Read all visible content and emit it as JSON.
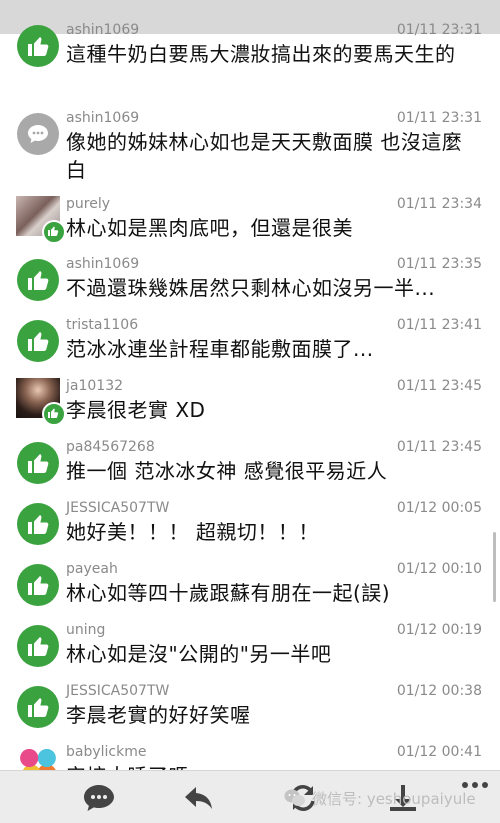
{
  "comments": [
    {
      "user": "ashin1069",
      "time": "01/11 23:31",
      "text": "這種牛奶白要馬大濃妝搞出來的要馬天生的",
      "avatar": "like"
    },
    {
      "user": "ashin1069",
      "time": "01/11 23:31",
      "text": "像她的姊妹林心如也是天天敷面膜 也沒這麼白",
      "avatar": "chat"
    },
    {
      "user": "purely",
      "time": "01/11 23:34",
      "text": "林心如是黑肉底吧，但還是很美",
      "avatar": "photo"
    },
    {
      "user": "ashin1069",
      "time": "01/11 23:35",
      "text": "不過還珠幾姝居然只剩林心如沒另一半...",
      "avatar": "like"
    },
    {
      "user": "trista1106",
      "time": "01/11 23:41",
      "text": "范冰冰連坐計程車都能敷面膜了...",
      "avatar": "like"
    },
    {
      "user": "ja10132",
      "time": "01/11 23:45",
      "text": "李晨很老實 XD",
      "avatar": "photo"
    },
    {
      "user": "pa84567268",
      "time": "01/11 23:45",
      "text": "推一個 范冰冰女神 感覺很平易近人",
      "avatar": "like"
    },
    {
      "user": "JESSICA507TW",
      "time": "01/12 00:05",
      "text": "她好美！！！ 超親切！！！",
      "avatar": "like"
    },
    {
      "user": "payeah",
      "time": "01/12 00:10",
      "text": "林心如等四十歲跟蘇有朋在一起(誤)",
      "avatar": "like"
    },
    {
      "user": "uning",
      "time": "01/12 00:19",
      "text": "林心如是沒\"公開的\"另一半吧",
      "avatar": "like"
    },
    {
      "user": "JESSICA507TW",
      "time": "01/12 00:38",
      "text": "李晨老實的好好笑喔",
      "avatar": "like"
    },
    {
      "user": "babylickme",
      "time": "01/12 00:41",
      "text": "安培大睡了嗎",
      "avatar": "photo"
    }
  ],
  "bottombar": {
    "icons": [
      "chat-icon",
      "back-icon",
      "refresh-icon",
      "download-icon",
      "more-icon"
    ],
    "watermark": "微信号: yeshoupaiyule"
  },
  "colors": {
    "like": "#3aa23f",
    "chat": "#a9a9a9",
    "meta": "#8a8a8a"
  }
}
